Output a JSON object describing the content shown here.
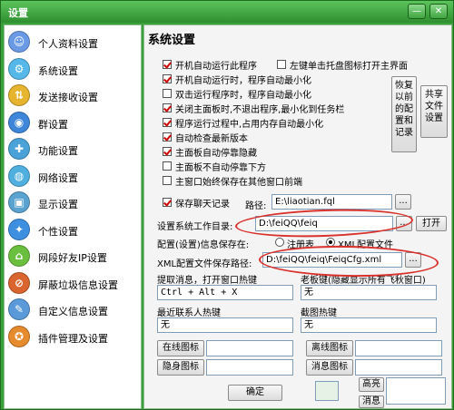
{
  "window": {
    "title": "设置",
    "minimize_glyph": "—",
    "close_glyph": "✕",
    "accent": "#3aa13a",
    "annotation_color": "#d9312c"
  },
  "sidebar": {
    "items": [
      {
        "label": "个人资料设置",
        "icon": "person-icon",
        "color": "#6a9ae6"
      },
      {
        "label": "系统设置",
        "icon": "system-icon",
        "color": "#55b8e8"
      },
      {
        "label": "发送接收设置",
        "icon": "send-receive-icon",
        "color": "#e6b42e"
      },
      {
        "label": "群设置",
        "icon": "group-icon",
        "color": "#3d86d9"
      },
      {
        "label": "功能设置",
        "icon": "function-icon",
        "color": "#4aa2d8"
      },
      {
        "label": "网络设置",
        "icon": "network-icon",
        "color": "#4fb0e0"
      },
      {
        "label": "显示设置",
        "icon": "display-icon",
        "color": "#5aa3d0"
      },
      {
        "label": "个性设置",
        "icon": "personalize-icon",
        "color": "#3e8fe0"
      },
      {
        "label": "网段好友IP设置",
        "icon": "ip-icon",
        "color": "#6bbf3e"
      },
      {
        "label": "屏蔽垃圾信息设置",
        "icon": "block-spam-icon",
        "color": "#d9642e"
      },
      {
        "label": "自定义信息设置",
        "icon": "custom-info-icon",
        "color": "#5a9ad8"
      },
      {
        "label": "插件管理及设置",
        "icon": "plugin-icon",
        "color": "#e68a2e"
      }
    ]
  },
  "main": {
    "title": "系统设置",
    "options": {
      "autostart": {
        "label": "开机自动运行此程序",
        "checked": true
      },
      "left_click_open": {
        "label": "左键单击托盘图标打开主界面",
        "checked": false
      },
      "autostart_minimized": {
        "label": "开机自动运行时，程序自动最小化",
        "checked": true
      },
      "doubleclick_minimize": {
        "label": "双击运行程序时，程序自动最小化",
        "checked": false
      },
      "close_to_taskbar": {
        "label": "关闭主面板时,不退出程序,最小化到任务栏",
        "checked": true
      },
      "manual_memory": {
        "label": "程序运行过程中,占用内存自动最小化",
        "checked": true
      },
      "check_update": {
        "label": "自动检查最新版本",
        "checked": true
      },
      "auto_dock_hide": {
        "label": "主面板自动停靠隐藏",
        "checked": true
      },
      "no_dock_bottom": {
        "label": "主面板不自动停靠下方",
        "checked": false
      },
      "always_on_top": {
        "label": "主窗口始终保存在其他窗口前端",
        "checked": false
      },
      "save_chat_log": {
        "label": "保存聊天记录",
        "checked": true
      }
    },
    "restore_button": "恢复以前的配置和记录",
    "share_button": "共享文件设置",
    "log_path_label": "路径:",
    "log_path_value": "E:\\liaotian.fql",
    "browse_label": "...",
    "workdir_label": "设置系统工作目录:",
    "workdir_value": "D:\\feiQQ\\feiq",
    "open_button": "打开",
    "save_config_label": "配置(设置)信息保存在:",
    "registry_radio": {
      "label": "注册表",
      "selected": false
    },
    "xml_radio": {
      "label": "XML配置文件",
      "selected": true
    },
    "xml_path_label": "XML配置文件保存路径:",
    "xml_path_value": "D:\\feiQQ\\feiq\\FeiqCfg.xml",
    "extract_hotkey_label": "提取消息，打开窗口热键",
    "extract_hotkey_value": "Ctrl + Alt + X",
    "hide_hotkey_label": "老板键(隐藏显示所有飞秋窗口)",
    "hide_hotkey_value": "无",
    "recent_contact_label": "最近联系人热键",
    "recent_contact_value": "无",
    "screenshot_label": "截图热键",
    "screenshot_value": "无",
    "online_icon_button": "在线图标",
    "offline_icon_button": "离线图标",
    "hidden_icon_button": "隐身图标",
    "message_icon_button": "消息图标",
    "high_button": "高亮",
    "message_short_button": "消息",
    "ok_button": "确定"
  }
}
